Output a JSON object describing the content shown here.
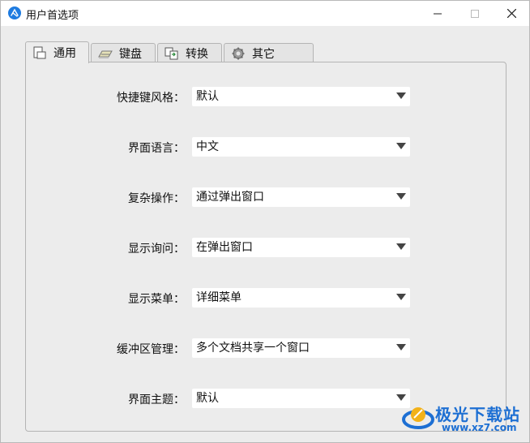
{
  "window": {
    "title": "用户首选项",
    "minimize_glyph": "—",
    "maximize_glyph": "☐",
    "close_glyph": "✕"
  },
  "tabs": [
    {
      "label": "通用",
      "icon": "page-icon",
      "active": true
    },
    {
      "label": "键盘",
      "icon": "keyboard-icon",
      "active": false
    },
    {
      "label": "转换",
      "icon": "convert-icon",
      "active": false
    },
    {
      "label": "其它",
      "icon": "gear-icon",
      "active": false
    }
  ],
  "settings": [
    {
      "label": "快捷键风格：",
      "value": "默认"
    },
    {
      "label": "界面语言：",
      "value": "中文"
    },
    {
      "label": "复杂操作：",
      "value": "通过弹出窗口"
    },
    {
      "label": "显示询问：",
      "value": "在弹出窗口"
    },
    {
      "label": "显示菜单：",
      "value": "详细菜单"
    },
    {
      "label": "缓冲区管理：",
      "value": "多个文档共享一个窗口"
    },
    {
      "label": "界面主题：",
      "value": "默认"
    }
  ],
  "watermark": {
    "text": "极光下载站",
    "url": "www.xz7.com"
  },
  "colors": {
    "accent": "#1e7be0",
    "watermark": "#1d6fd3",
    "panel_bg": "#ececec",
    "field_bg": "#ffffff"
  }
}
